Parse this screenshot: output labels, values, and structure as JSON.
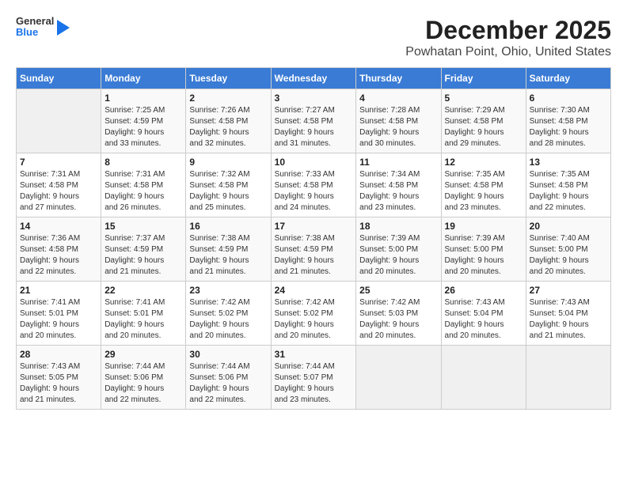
{
  "header": {
    "logo": {
      "line1": "General",
      "line2": "Blue"
    },
    "title": "December 2025",
    "subtitle": "Powhatan Point, Ohio, United States"
  },
  "days_of_week": [
    "Sunday",
    "Monday",
    "Tuesday",
    "Wednesday",
    "Thursday",
    "Friday",
    "Saturday"
  ],
  "weeks": [
    [
      {
        "day": "",
        "info": ""
      },
      {
        "day": "1",
        "info": "Sunrise: 7:25 AM\nSunset: 4:59 PM\nDaylight: 9 hours\nand 33 minutes."
      },
      {
        "day": "2",
        "info": "Sunrise: 7:26 AM\nSunset: 4:58 PM\nDaylight: 9 hours\nand 32 minutes."
      },
      {
        "day": "3",
        "info": "Sunrise: 7:27 AM\nSunset: 4:58 PM\nDaylight: 9 hours\nand 31 minutes."
      },
      {
        "day": "4",
        "info": "Sunrise: 7:28 AM\nSunset: 4:58 PM\nDaylight: 9 hours\nand 30 minutes."
      },
      {
        "day": "5",
        "info": "Sunrise: 7:29 AM\nSunset: 4:58 PM\nDaylight: 9 hours\nand 29 minutes."
      },
      {
        "day": "6",
        "info": "Sunrise: 7:30 AM\nSunset: 4:58 PM\nDaylight: 9 hours\nand 28 minutes."
      }
    ],
    [
      {
        "day": "7",
        "info": "Sunrise: 7:31 AM\nSunset: 4:58 PM\nDaylight: 9 hours\nand 27 minutes."
      },
      {
        "day": "8",
        "info": "Sunrise: 7:31 AM\nSunset: 4:58 PM\nDaylight: 9 hours\nand 26 minutes."
      },
      {
        "day": "9",
        "info": "Sunrise: 7:32 AM\nSunset: 4:58 PM\nDaylight: 9 hours\nand 25 minutes."
      },
      {
        "day": "10",
        "info": "Sunrise: 7:33 AM\nSunset: 4:58 PM\nDaylight: 9 hours\nand 24 minutes."
      },
      {
        "day": "11",
        "info": "Sunrise: 7:34 AM\nSunset: 4:58 PM\nDaylight: 9 hours\nand 23 minutes."
      },
      {
        "day": "12",
        "info": "Sunrise: 7:35 AM\nSunset: 4:58 PM\nDaylight: 9 hours\nand 23 minutes."
      },
      {
        "day": "13",
        "info": "Sunrise: 7:35 AM\nSunset: 4:58 PM\nDaylight: 9 hours\nand 22 minutes."
      }
    ],
    [
      {
        "day": "14",
        "info": "Sunrise: 7:36 AM\nSunset: 4:58 PM\nDaylight: 9 hours\nand 22 minutes."
      },
      {
        "day": "15",
        "info": "Sunrise: 7:37 AM\nSunset: 4:59 PM\nDaylight: 9 hours\nand 21 minutes."
      },
      {
        "day": "16",
        "info": "Sunrise: 7:38 AM\nSunset: 4:59 PM\nDaylight: 9 hours\nand 21 minutes."
      },
      {
        "day": "17",
        "info": "Sunrise: 7:38 AM\nSunset: 4:59 PM\nDaylight: 9 hours\nand 21 minutes."
      },
      {
        "day": "18",
        "info": "Sunrise: 7:39 AM\nSunset: 5:00 PM\nDaylight: 9 hours\nand 20 minutes."
      },
      {
        "day": "19",
        "info": "Sunrise: 7:39 AM\nSunset: 5:00 PM\nDaylight: 9 hours\nand 20 minutes."
      },
      {
        "day": "20",
        "info": "Sunrise: 7:40 AM\nSunset: 5:00 PM\nDaylight: 9 hours\nand 20 minutes."
      }
    ],
    [
      {
        "day": "21",
        "info": "Sunrise: 7:41 AM\nSunset: 5:01 PM\nDaylight: 9 hours\nand 20 minutes."
      },
      {
        "day": "22",
        "info": "Sunrise: 7:41 AM\nSunset: 5:01 PM\nDaylight: 9 hours\nand 20 minutes."
      },
      {
        "day": "23",
        "info": "Sunrise: 7:42 AM\nSunset: 5:02 PM\nDaylight: 9 hours\nand 20 minutes."
      },
      {
        "day": "24",
        "info": "Sunrise: 7:42 AM\nSunset: 5:02 PM\nDaylight: 9 hours\nand 20 minutes."
      },
      {
        "day": "25",
        "info": "Sunrise: 7:42 AM\nSunset: 5:03 PM\nDaylight: 9 hours\nand 20 minutes."
      },
      {
        "day": "26",
        "info": "Sunrise: 7:43 AM\nSunset: 5:04 PM\nDaylight: 9 hours\nand 20 minutes."
      },
      {
        "day": "27",
        "info": "Sunrise: 7:43 AM\nSunset: 5:04 PM\nDaylight: 9 hours\nand 21 minutes."
      }
    ],
    [
      {
        "day": "28",
        "info": "Sunrise: 7:43 AM\nSunset: 5:05 PM\nDaylight: 9 hours\nand 21 minutes."
      },
      {
        "day": "29",
        "info": "Sunrise: 7:44 AM\nSunset: 5:06 PM\nDaylight: 9 hours\nand 22 minutes."
      },
      {
        "day": "30",
        "info": "Sunrise: 7:44 AM\nSunset: 5:06 PM\nDaylight: 9 hours\nand 22 minutes."
      },
      {
        "day": "31",
        "info": "Sunrise: 7:44 AM\nSunset: 5:07 PM\nDaylight: 9 hours\nand 23 minutes."
      },
      {
        "day": "",
        "info": ""
      },
      {
        "day": "",
        "info": ""
      },
      {
        "day": "",
        "info": ""
      }
    ]
  ]
}
